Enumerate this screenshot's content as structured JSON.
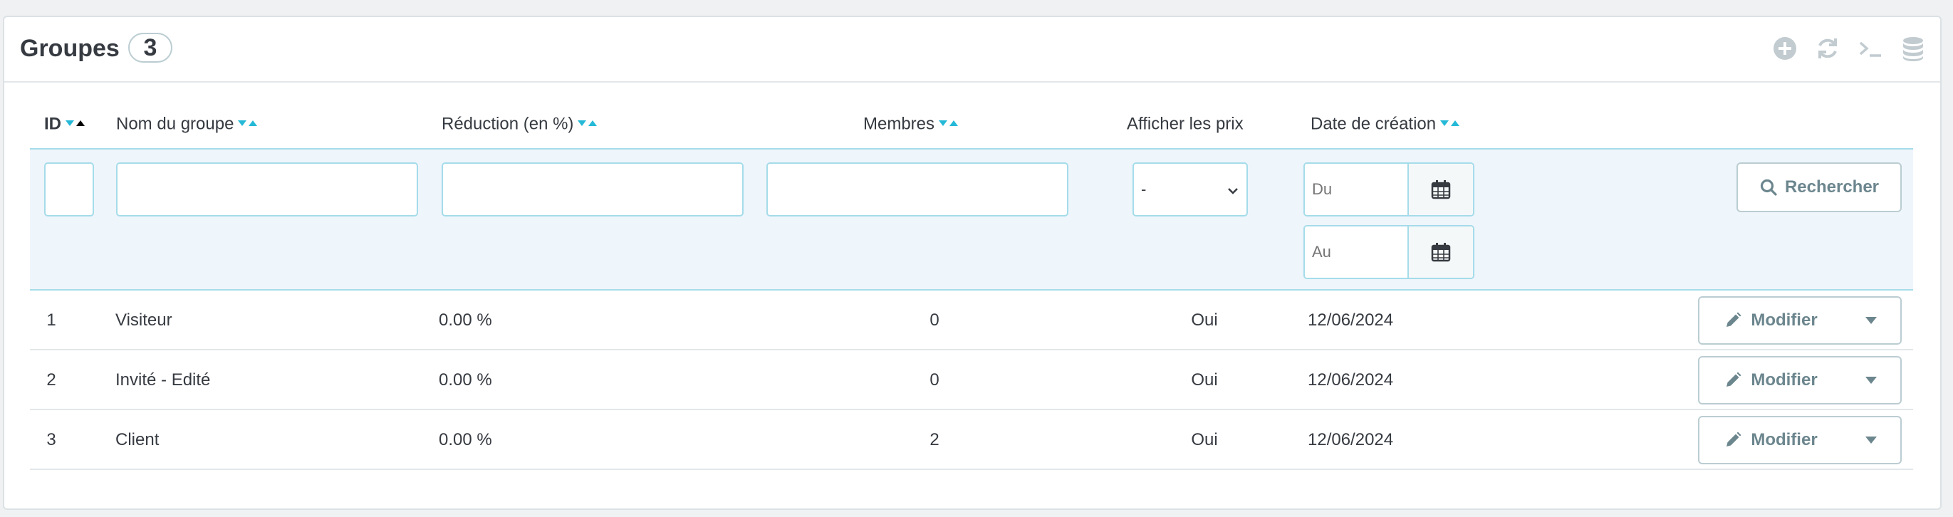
{
  "panel": {
    "title": "Groupes",
    "count": "3",
    "toolbar": [
      "add-icon",
      "refresh-icon",
      "sql-icon",
      "database-icon"
    ]
  },
  "columns": {
    "id": "ID",
    "name": "Nom du groupe",
    "reduction": "Réduction (en %)",
    "members": "Membres",
    "show_prices": "Afficher les prix",
    "date": "Date de création"
  },
  "filters": {
    "id_value": "",
    "name_value": "",
    "reduction_value": "",
    "members_value": "",
    "show_prices_selected": "-",
    "date_from_placeholder": "Du",
    "date_to_placeholder": "Au",
    "search_label": "Rechercher"
  },
  "rows": [
    {
      "id": "1",
      "name": "Visiteur",
      "reduction": "0.00 %",
      "members": "0",
      "show_prices": "Oui",
      "date": "12/06/2024",
      "action": "Modifier"
    },
    {
      "id": "2",
      "name": "Invité - Edité",
      "reduction": "0.00 %",
      "members": "0",
      "show_prices": "Oui",
      "date": "12/06/2024",
      "action": "Modifier"
    },
    {
      "id": "3",
      "name": "Client",
      "reduction": "0.00 %",
      "members": "2",
      "show_prices": "Oui",
      "date": "12/06/2024",
      "action": "Modifier"
    }
  ],
  "colors": {
    "accent": "#25b9d7",
    "filter_bg": "#eef5fb",
    "text": "#363a41",
    "muted": "#6c868e"
  }
}
